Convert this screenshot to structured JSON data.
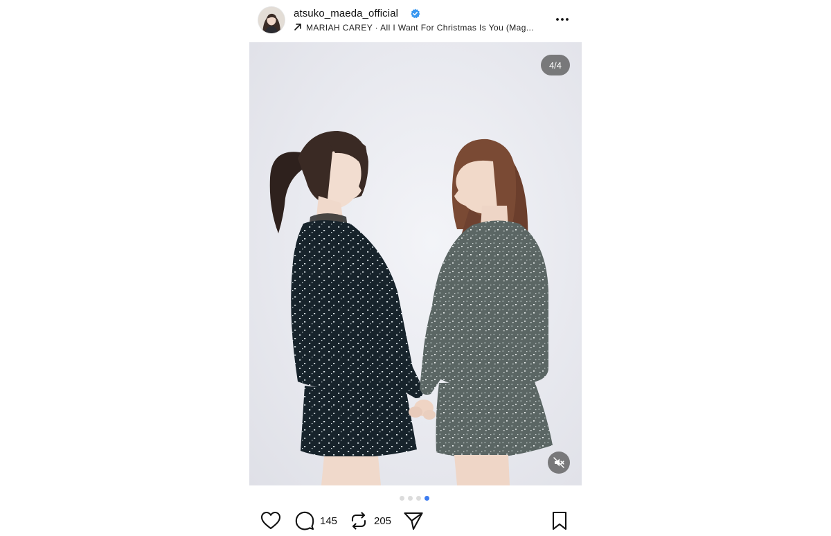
{
  "post": {
    "username": "atsuko_maeda_official",
    "verified": true,
    "music": "MARIAH CAREY · All I Want For Christmas Is You (Mag...",
    "slide_counter": "4/4",
    "slide_count": 4,
    "active_slide": 4
  },
  "actions": {
    "comment_count": "145",
    "repost_count": "205"
  },
  "icons": {
    "more": "more-horizontal-icon",
    "music": "arrow-up-right-icon",
    "verified": "verified-badge-icon",
    "mute": "speaker-muted-icon",
    "like": "heart-icon",
    "comment": "comment-bubble-icon",
    "repost": "repost-arrows-icon",
    "share": "paper-plane-icon",
    "save": "bookmark-icon"
  },
  "colors": {
    "verified": "#3897f0",
    "active_dot": "#3d7cf0",
    "inactive_dot": "#dcdcdc"
  }
}
